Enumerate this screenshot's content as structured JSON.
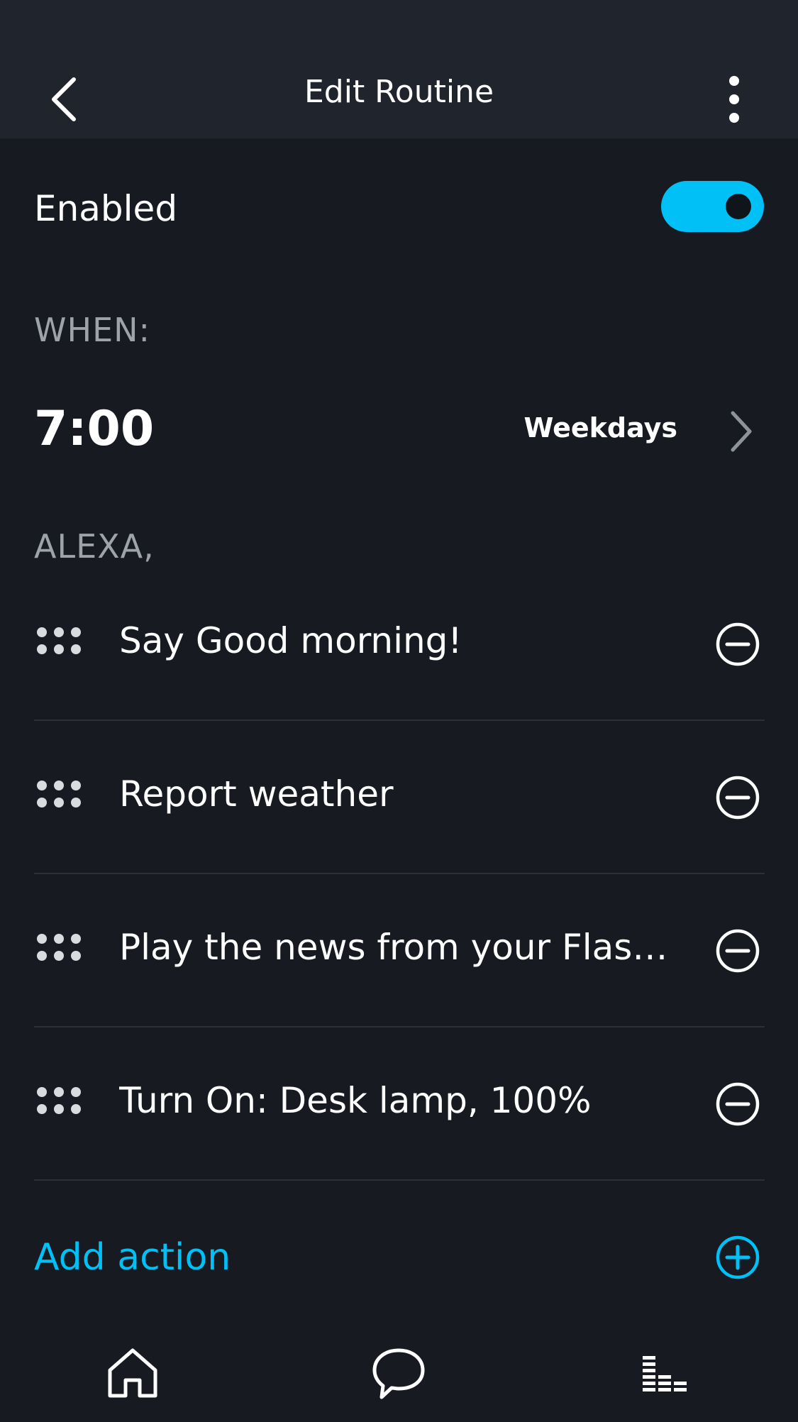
{
  "header": {
    "title": "Edit Routine",
    "back_icon": "chevron-left-icon",
    "more_icon": "more-vertical-icon"
  },
  "enabled": {
    "label": "Enabled",
    "on": true,
    "accent_color": "#00c0f6"
  },
  "when": {
    "section_label": "WHEN:",
    "time": "7:00",
    "days": "Weekdays"
  },
  "alexa": {
    "section_label": "ALEXA,",
    "actions": [
      {
        "label": "Say Good morning!"
      },
      {
        "label": "Report weather"
      },
      {
        "label": "Play the news from your Flash…"
      },
      {
        "label": "Turn On: Desk lamp, 100%"
      }
    ],
    "add_action_label": "Add action"
  },
  "nav": {
    "items": [
      {
        "icon": "home-icon"
      },
      {
        "icon": "chat-bubble-icon"
      },
      {
        "icon": "activity-bars-icon"
      }
    ]
  }
}
